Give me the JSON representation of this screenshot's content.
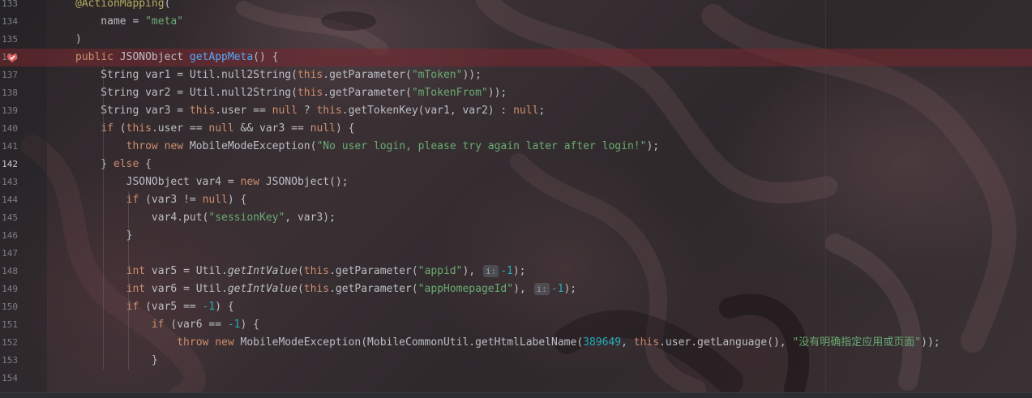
{
  "editor": {
    "lines": [
      {
        "number": "133",
        "tokens": [
          {
            "t": "@ActionMapping",
            "c": "ann"
          },
          {
            "t": "(",
            "c": ""
          }
        ]
      },
      {
        "number": "134",
        "tokens": [
          {
            "t": "    name = ",
            "c": ""
          },
          {
            "t": "\"meta\"",
            "c": "str"
          }
        ]
      },
      {
        "number": "135",
        "tokens": [
          {
            "t": ")",
            "c": ""
          }
        ]
      },
      {
        "number": "136",
        "tokens": [
          {
            "t": "public ",
            "c": "kw"
          },
          {
            "t": "JSONObject ",
            "c": ""
          },
          {
            "t": "getAppMeta",
            "c": "fn"
          },
          {
            "t": "() {",
            "c": ""
          }
        ]
      },
      {
        "number": "137",
        "tokens": [
          {
            "t": "    String var1 = Util.null2String(",
            "c": ""
          },
          {
            "t": "this",
            "c": "kw"
          },
          {
            "t": ".getParameter(",
            "c": ""
          },
          {
            "t": "\"mToken\"",
            "c": "str"
          },
          {
            "t": "));",
            "c": ""
          }
        ]
      },
      {
        "number": "138",
        "tokens": [
          {
            "t": "    String var2 = Util.null2String(",
            "c": ""
          },
          {
            "t": "this",
            "c": "kw"
          },
          {
            "t": ".getParameter(",
            "c": ""
          },
          {
            "t": "\"mTokenFrom\"",
            "c": "str"
          },
          {
            "t": "));",
            "c": ""
          }
        ]
      },
      {
        "number": "139",
        "tokens": [
          {
            "t": "    String var3 = ",
            "c": ""
          },
          {
            "t": "this",
            "c": "kw"
          },
          {
            "t": ".user == ",
            "c": ""
          },
          {
            "t": "null",
            "c": "kw"
          },
          {
            "t": " ? ",
            "c": ""
          },
          {
            "t": "this",
            "c": "kw"
          },
          {
            "t": ".getTokenKey(var1, var2) : ",
            "c": ""
          },
          {
            "t": "null",
            "c": "kw"
          },
          {
            "t": ";",
            "c": ""
          }
        ]
      },
      {
        "number": "140",
        "tokens": [
          {
            "t": "    ",
            "c": ""
          },
          {
            "t": "if",
            "c": "kw"
          },
          {
            "t": " (",
            "c": ""
          },
          {
            "t": "this",
            "c": "kw"
          },
          {
            "t": ".user == ",
            "c": ""
          },
          {
            "t": "null",
            "c": "kw"
          },
          {
            "t": " && var3 == ",
            "c": ""
          },
          {
            "t": "null",
            "c": "kw"
          },
          {
            "t": ") {",
            "c": ""
          }
        ]
      },
      {
        "number": "141",
        "tokens": [
          {
            "t": "        ",
            "c": ""
          },
          {
            "t": "throw new ",
            "c": "kw"
          },
          {
            "t": "MobileModeException(",
            "c": ""
          },
          {
            "t": "\"No user login, please try again later after login!\"",
            "c": "str"
          },
          {
            "t": ");",
            "c": ""
          }
        ]
      },
      {
        "number": "142",
        "tokens": [
          {
            "t": "    } ",
            "c": ""
          },
          {
            "t": "else",
            "c": "kw"
          },
          {
            "t": " {",
            "c": ""
          }
        ]
      },
      {
        "number": "143",
        "tokens": [
          {
            "t": "        JSONObject var4 = ",
            "c": ""
          },
          {
            "t": "new ",
            "c": "kw"
          },
          {
            "t": "JSONObject();",
            "c": ""
          }
        ]
      },
      {
        "number": "144",
        "tokens": [
          {
            "t": "        ",
            "c": ""
          },
          {
            "t": "if",
            "c": "kw"
          },
          {
            "t": " (var3 != ",
            "c": ""
          },
          {
            "t": "null",
            "c": "kw"
          },
          {
            "t": ") {",
            "c": ""
          }
        ]
      },
      {
        "number": "145",
        "tokens": [
          {
            "t": "            var4.put(",
            "c": ""
          },
          {
            "t": "\"sessionKey\"",
            "c": "str"
          },
          {
            "t": ", var3);",
            "c": ""
          }
        ]
      },
      {
        "number": "146",
        "tokens": [
          {
            "t": "        }",
            "c": ""
          }
        ]
      },
      {
        "number": "147",
        "tokens": []
      },
      {
        "number": "148",
        "tokens": [
          {
            "t": "        ",
            "c": ""
          },
          {
            "t": "int",
            "c": "kw"
          },
          {
            "t": " var5 = Util.",
            "c": ""
          },
          {
            "t": "getIntValue",
            "c": "static-call"
          },
          {
            "t": "(",
            "c": ""
          },
          {
            "t": "this",
            "c": "kw"
          },
          {
            "t": ".getParameter(",
            "c": ""
          },
          {
            "t": "\"appid\"",
            "c": "str"
          },
          {
            "t": "), ",
            "c": ""
          },
          {
            "t": "i:",
            "c": "hint"
          },
          {
            "t": "-1",
            "c": "num"
          },
          {
            "t": ");",
            "c": ""
          }
        ]
      },
      {
        "number": "149",
        "tokens": [
          {
            "t": "        ",
            "c": ""
          },
          {
            "t": "int",
            "c": "kw"
          },
          {
            "t": " var6 = Util.",
            "c": ""
          },
          {
            "t": "getIntValue",
            "c": "static-call"
          },
          {
            "t": "(",
            "c": ""
          },
          {
            "t": "this",
            "c": "kw"
          },
          {
            "t": ".getParameter(",
            "c": ""
          },
          {
            "t": "\"appHomepageId\"",
            "c": "str"
          },
          {
            "t": "), ",
            "c": ""
          },
          {
            "t": "i:",
            "c": "hint"
          },
          {
            "t": "-1",
            "c": "num"
          },
          {
            "t": ");",
            "c": ""
          }
        ]
      },
      {
        "number": "150",
        "tokens": [
          {
            "t": "        ",
            "c": ""
          },
          {
            "t": "if",
            "c": "kw"
          },
          {
            "t": " (var5 == ",
            "c": ""
          },
          {
            "t": "-1",
            "c": "num"
          },
          {
            "t": ") {",
            "c": ""
          }
        ]
      },
      {
        "number": "151",
        "tokens": [
          {
            "t": "            ",
            "c": ""
          },
          {
            "t": "if",
            "c": "kw"
          },
          {
            "t": " (var6 == ",
            "c": ""
          },
          {
            "t": "-1",
            "c": "num"
          },
          {
            "t": ") {",
            "c": ""
          }
        ]
      },
      {
        "number": "152",
        "tokens": [
          {
            "t": "                ",
            "c": ""
          },
          {
            "t": "throw new ",
            "c": "kw"
          },
          {
            "t": "MobileModeException(MobileCommonUtil.getHtmlLabelName(",
            "c": ""
          },
          {
            "t": "389649",
            "c": "num"
          },
          {
            "t": ", ",
            "c": ""
          },
          {
            "t": "this",
            "c": "kw"
          },
          {
            "t": ".user.getLanguage(), ",
            "c": ""
          },
          {
            "t": "\"没有明确指定应用或页面\"",
            "c": "str"
          },
          {
            "t": "));",
            "c": ""
          }
        ]
      },
      {
        "number": "153",
        "tokens": [
          {
            "t": "            }",
            "c": ""
          }
        ]
      },
      {
        "number": "154",
        "tokens": []
      }
    ],
    "breakpoint_line": "136",
    "caret_line": "142",
    "colors": {
      "keyword": "#cf8e6d",
      "string": "#6aab73",
      "annotation": "#b3ae60",
      "method_declaration": "#56a8f5",
      "number": "#2aacb8",
      "default_text": "#bcbec4",
      "breakpoint_line_bg": "#782830",
      "line_number": "#7d7f86"
    },
    "icons": {
      "breakpoint": "breakpoint-check-icon",
      "inlay_hint": "parameter-hint"
    }
  }
}
